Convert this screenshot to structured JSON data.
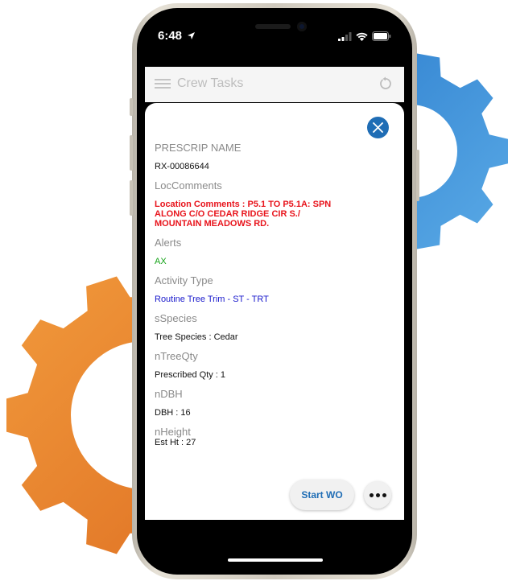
{
  "status_bar": {
    "time": "6:48"
  },
  "app_header": {
    "title": "Crew Tasks"
  },
  "task_detail": {
    "fields": [
      {
        "label": "PRESCRIP NAME",
        "value": "RX-00086644",
        "style": "black"
      },
      {
        "label": "LocComments",
        "value": "Location Comments : P5.1 TO P5.1A: SPN ALONG C/O CEDAR RIDGE CIR S./ MOUNTAIN MEADOWS RD.",
        "style": "red"
      },
      {
        "label": "Alerts",
        "value": "AX",
        "style": "green"
      },
      {
        "label": "Activity Type",
        "value": "Routine Tree Trim - ST - TRT",
        "style": "blue"
      },
      {
        "label": "sSpecies",
        "value": "Tree Species : Cedar",
        "style": "black"
      },
      {
        "label": "nTreeQty",
        "value": "Prescribed Qty : 1",
        "style": "black"
      },
      {
        "label": "nDBH",
        "value": "DBH : 16",
        "style": "black"
      },
      {
        "label": "nHeight",
        "value": "Est Ht : 27",
        "style": "black"
      }
    ],
    "start_button_label": "Start WO"
  },
  "colors": {
    "accent": "#1f6db5",
    "gear_orange": "#e9842b",
    "gear_blue": "#3b8fd6",
    "text_red": "#e8141c",
    "text_green": "#17a31a",
    "text_blue": "#1a1acc"
  },
  "icons": [
    "menu-icon",
    "refresh-icon",
    "close-icon",
    "more-icon",
    "location-arrow-icon",
    "signal-icon",
    "wifi-icon",
    "battery-icon"
  ]
}
